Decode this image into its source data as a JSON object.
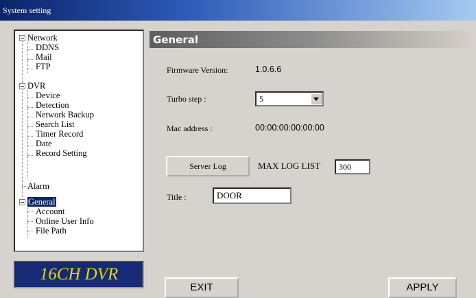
{
  "window": {
    "title": "System setting"
  },
  "tree": {
    "network": "Network",
    "ddns": "DDNS",
    "mail": "Mail",
    "ftp": "FTP",
    "dvr": "DVR",
    "device": "Device",
    "detection": "Detection",
    "network_backup": "Network Backup",
    "search_list": "Search List",
    "timer_record": "Timer Record",
    "date": "Date",
    "record_setting": "Record Setting",
    "alarm": "Alarm",
    "general": "General",
    "account": "Account",
    "online_user_info": "Online User Info",
    "file_path": "File Path"
  },
  "logo": "16CH DVR",
  "panel": {
    "header": "General",
    "firmware_label": "Firmware Version:",
    "firmware_value": "1.0.6.6",
    "turbo_label": "Turbo step :",
    "turbo_value": "5",
    "mac_label": "Mac address :",
    "mac_value": "00:00:00:00:00:00",
    "server_log_button": "Server Log",
    "max_log_label": "MAX LOG LIST",
    "max_log_value": "300",
    "title_label": "Title :",
    "title_value": "DOOR"
  },
  "buttons": {
    "exit": "EXIT",
    "apply": "APPLY"
  }
}
